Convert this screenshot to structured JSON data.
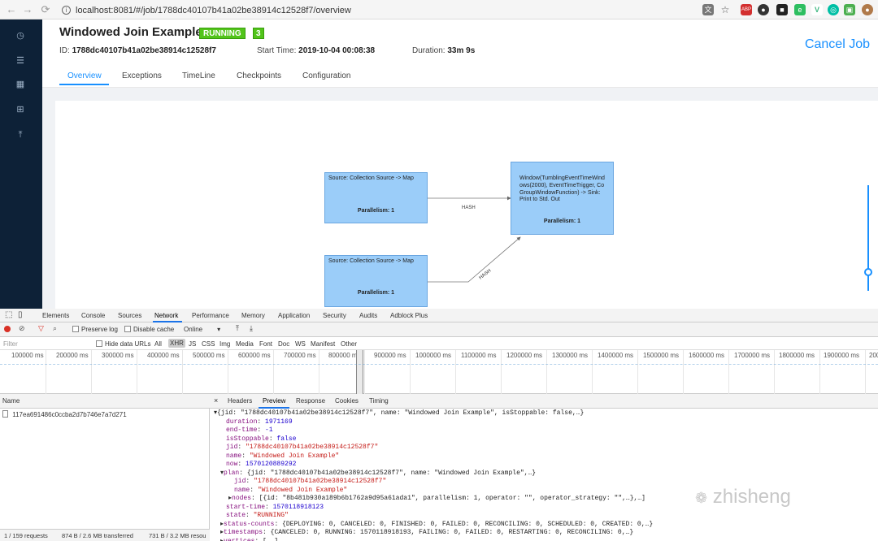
{
  "browser": {
    "url": "localhost:8081/#/job/1788dc40107b41a02be38914c12528f7/overview"
  },
  "job": {
    "title": "Windowed Join Example",
    "state_badge": "RUNNING",
    "count_badge": "3",
    "id_label": "ID:",
    "id_value": "1788dc40107b41a02be38914c12528f7",
    "start_label": "Start Time:",
    "start_value": "2019-10-04 00:08:38",
    "duration_label": "Duration:",
    "duration_value": "33m 9s",
    "cancel_label": "Cancel Job",
    "tabs": [
      "Overview",
      "Exceptions",
      "TimeLine",
      "Checkpoints",
      "Configuration"
    ]
  },
  "graph": {
    "nodes": [
      {
        "label": "Source: Collection Source -> Map",
        "parallelism": "Parallelism: 1"
      },
      {
        "label": "Source: Collection Source -> Map",
        "parallelism": "Parallelism: 1"
      },
      {
        "label": "Window(TumblingEventTimeWindows(2000), EventTimeTrigger, CoGroupWindowFunction) -> Sink: Print to Std. Out",
        "parallelism": "Parallelism: 1"
      }
    ],
    "edges": [
      "HASH",
      "HASH"
    ]
  },
  "devtools": {
    "tabs": [
      "Elements",
      "Console",
      "Sources",
      "Network",
      "Performance",
      "Memory",
      "Application",
      "Security",
      "Audits",
      "Adblock Plus"
    ],
    "toolbar": {
      "preserve_log": "Preserve log",
      "disable_cache": "Disable cache",
      "throttle": "Online"
    },
    "filter": {
      "placeholder": "Filter",
      "hide_data_urls": "Hide data URLs",
      "types": [
        "All",
        "XHR",
        "JS",
        "CSS",
        "Img",
        "Media",
        "Font",
        "Doc",
        "WS",
        "Manifest",
        "Other"
      ]
    },
    "timeline_ticks": [
      "100000 ms",
      "200000 ms",
      "300000 ms",
      "400000 ms",
      "500000 ms",
      "600000 ms",
      "700000 ms",
      "800000 ms",
      "900000 ms",
      "1000000 ms",
      "1100000 ms",
      "1200000 ms",
      "1300000 ms",
      "1400000 ms",
      "1500000 ms",
      "1600000 ms",
      "1700000 ms",
      "1800000 ms",
      "1900000 ms",
      "200"
    ],
    "name_header": "Name",
    "detail_tabs": [
      "Headers",
      "Preview",
      "Response",
      "Cookies",
      "Timing"
    ],
    "requests": [
      "117ea691486c0ccba2d7b746e7a7d271"
    ],
    "status": {
      "requests": "1 / 159 requests",
      "transferred": "874 B / 2.6 MB transferred",
      "resources": "731 B / 3.2 MB resou"
    },
    "preview": {
      "root": "{jid: \"1788dc40107b41a02be38914c12528f7\", name: \"Windowed Join Example\", isStoppable: false,…}",
      "duration": "1971169",
      "end_time": "-1",
      "isStoppable": "false",
      "jid": "\"1788dc40107b41a02be38914c12528f7\"",
      "name": "\"Windowed Join Example\"",
      "now": "1570120889292",
      "plan": "{jid: \"1788dc40107b41a02be38914c12528f7\", name: \"Windowed Join Example\",…}",
      "plan_jid": "\"1788dc40107b41a02be38914c12528f7\"",
      "plan_name": "\"Windowed Join Example\"",
      "plan_nodes": "[{id: \"8b481b930a189b6b1762a9d95a61ada1\", parallelism: 1, operator: \"\", operator_strategy: \"\",…},…]",
      "start_time": "1570118918123",
      "state": "\"RUNNING\"",
      "status_counts": "{DEPLOYING: 0, CANCELED: 0, FINISHED: 0, FAILED: 0, RECONCILING: 0, SCHEDULED: 0, CREATED: 0,…}",
      "timestamps": "{CANCELED: 0, RUNNING: 1570118918193, FAILING: 0, FAILED: 0, RESTARTING: 0, RECONCILING: 0,…}",
      "vertices": "[,…]"
    }
  },
  "watermark": "zhisheng",
  "colors": {
    "accent": "#1890ff",
    "running": "#52c41a",
    "node_fill": "#9bcdf9",
    "sidebar": "#0d2137"
  }
}
